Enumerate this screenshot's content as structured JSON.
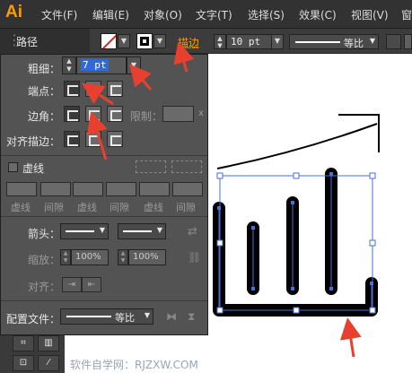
{
  "app": {
    "logo": "Ai"
  },
  "menu": [
    "文件(F)",
    "编辑(E)",
    "对象(O)",
    "文字(T)",
    "选择(S)",
    "效果(C)",
    "视图(V)",
    "窗"
  ],
  "control_bar": {
    "selection_label": "路径",
    "stroke_link_label": "描边",
    "stroke_weight_value": "10 pt",
    "profile_label": "等比"
  },
  "stroke_panel": {
    "weight_label": "粗细：",
    "weight_value": "7 pt",
    "cap_label": "端点：",
    "corner_label": "边角：",
    "limit_label": "限制：",
    "limit_suffix": "x",
    "align_label": "对齐描边：",
    "dashed_label": "虚线",
    "dash_labels": [
      "虚线",
      "间隙",
      "虚线",
      "间隙",
      "虚线",
      "间隙"
    ],
    "arrow_label": "箭头：",
    "scale_label": "缩放：",
    "scale_start": "100%",
    "scale_end": "100%",
    "align_arrow_label": "对齐：",
    "profile_label": "配置文件：",
    "profile_value": "等比"
  },
  "watermark": "软件自学网：RJZXW.COM",
  "colors": {
    "accent": "#ff9a00",
    "panel_bg": "#535353",
    "annotation_arrow": "#e8402f",
    "selection_blue": "#4a6fd8"
  }
}
